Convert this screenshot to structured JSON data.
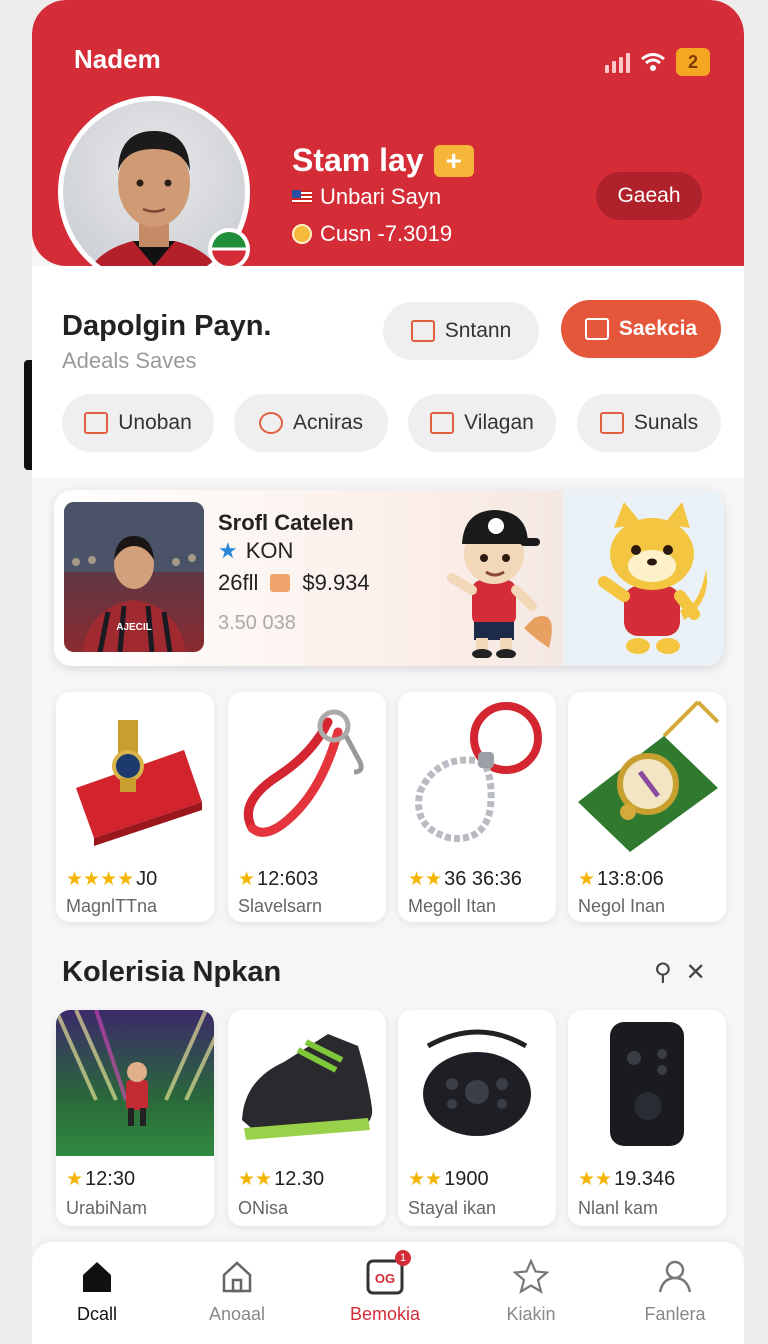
{
  "header": {
    "app_name": "Nadem",
    "notification_count": "2",
    "user_title": "Stam lay",
    "user_country": "Unbari Sayn",
    "user_coins": "Cusn -7.3019",
    "action_button": "Gaeah"
  },
  "panel": {
    "title": "Dapolgin Payn.",
    "subtitle": "Adeals Saves",
    "primary_buttons": [
      {
        "label": "Sntann",
        "icon": "store-icon"
      },
      {
        "label": "Saekcia",
        "icon": "bag-icon"
      }
    ],
    "categories": [
      {
        "label": "Unoban",
        "icon": "home-icon"
      },
      {
        "label": "Acniras",
        "icon": "ball-icon"
      },
      {
        "label": "Vilagan",
        "icon": "shop-icon"
      },
      {
        "label": "Sunals",
        "icon": "ticket-icon"
      }
    ]
  },
  "banner": {
    "title": "Srofl  Catelen",
    "tag": "KON",
    "sub_a": "26fll",
    "price": "$9.934",
    "count": "3.50 038"
  },
  "products": [
    {
      "rating": "J0",
      "stars": 4,
      "name": "MagnlTTna"
    },
    {
      "rating": "12:603",
      "stars": 1,
      "name": "Slavelsarn"
    },
    {
      "rating": "36 36:36",
      "stars": 2,
      "name": "Megoll Itan"
    },
    {
      "rating": "13:8:06",
      "stars": 1,
      "name": "Negol Inan"
    }
  ],
  "collection": {
    "title": "Kolerisia Npkan",
    "items": [
      {
        "rating": "12:30",
        "stars": 1,
        "name": "UrabiNam"
      },
      {
        "rating": "12.30",
        "stars": 2,
        "name": "ONisa"
      },
      {
        "rating": "1900",
        "stars": 2,
        "name": "Stayal ikan"
      },
      {
        "rating": "19.346",
        "stars": 2,
        "name": "Nlanl kam"
      }
    ]
  },
  "nav": {
    "items": [
      {
        "label": "Dcall",
        "icon": "home-icon"
      },
      {
        "label": "Anoaal",
        "icon": "house-outline-icon"
      },
      {
        "label": "Bemokia",
        "icon": "og-icon",
        "badge": "1"
      },
      {
        "label": "Kiakin",
        "icon": "star-icon"
      },
      {
        "label": "Fanlera",
        "icon": "profile-icon"
      }
    ]
  },
  "colors": {
    "brand_red": "#d42d37",
    "accent_orange": "#e4573a",
    "star_gold": "#f5b400"
  }
}
